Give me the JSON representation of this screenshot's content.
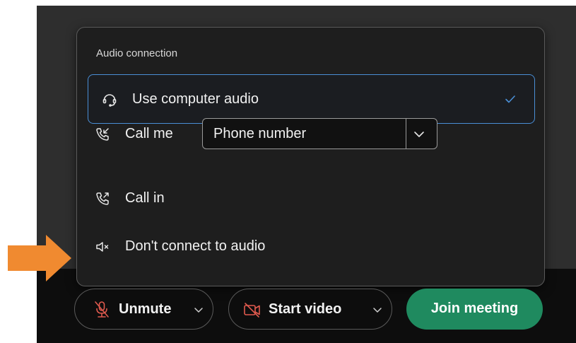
{
  "audio_popover": {
    "title": "Audio connection",
    "options": [
      {
        "label": "Use computer audio",
        "icon": "headset-icon",
        "selected": true
      },
      {
        "label": "Call me",
        "icon": "phone-incoming-icon",
        "selected": false
      },
      {
        "label": "Call in",
        "icon": "phone-outgoing-icon",
        "selected": false
      },
      {
        "label": "Don't connect to audio",
        "icon": "speaker-muted-icon",
        "selected": false
      }
    ],
    "phone_select": {
      "value": "Phone number"
    }
  },
  "toolbar": {
    "unmute_label": "Unmute",
    "start_video_label": "Start video",
    "join_label": "Join meeting"
  },
  "colors": {
    "accent_blue": "#4a8fd6",
    "join_green": "#1f8a5f",
    "muted_red": "#e05a4e",
    "annotation_orange": "#f08a30"
  }
}
